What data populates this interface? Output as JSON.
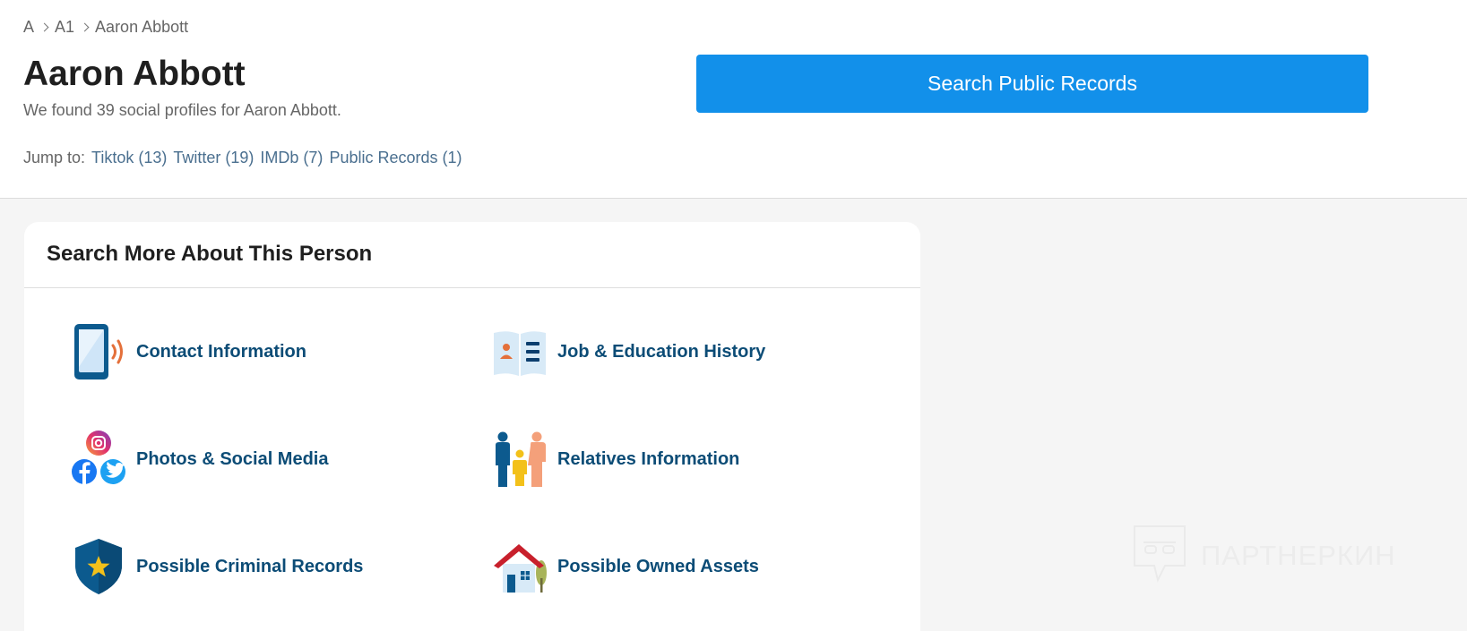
{
  "breadcrumb": [
    "A",
    "A1",
    "Aaron Abbott"
  ],
  "header": {
    "title": "Aaron Abbott",
    "subtitle": "We found 39 social profiles for Aaron Abbott.",
    "jump_label": "Jump to:",
    "jump_links": [
      "Tiktok (13)",
      "Twitter (19)",
      "IMDb (7)",
      "Public Records (1)"
    ]
  },
  "search_button": {
    "label": "Search Public Records",
    "color": "#1290ea"
  },
  "card": {
    "title": "Search More About This Person",
    "items": [
      {
        "label": "Contact Information",
        "icon": "phone-icon"
      },
      {
        "label": "Job & Education History",
        "icon": "book-icon"
      },
      {
        "label": "Photos & Social Media",
        "icon": "social-media-icon"
      },
      {
        "label": "Relatives Information",
        "icon": "family-icon"
      },
      {
        "label": "Possible Criminal Records",
        "icon": "shield-star-icon"
      },
      {
        "label": "Possible Owned Assets",
        "icon": "house-icon"
      }
    ]
  },
  "colors": {
    "item_label": "#0c4c76",
    "link": "#4a6f8f"
  },
  "watermark": {
    "text": "ПАРТНЕРКИН"
  }
}
